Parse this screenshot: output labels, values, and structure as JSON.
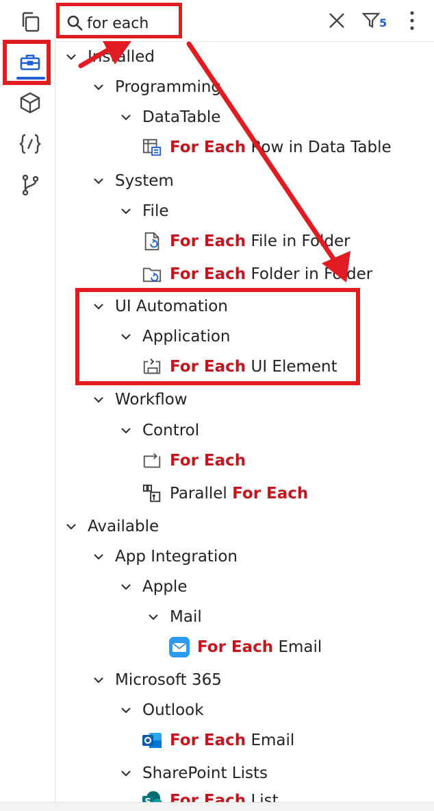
{
  "search": {
    "value": "for each"
  },
  "toolbar": {
    "filter_count": "5"
  },
  "rail_icons": [
    "files-icon",
    "toolbox-icon",
    "package-icon",
    "code-braces-icon",
    "git-branch-icon"
  ],
  "tree": {
    "installed": "Installed",
    "programming": "Programming",
    "datatable": "DataTable",
    "row_in_datatable": {
      "hl": "For Each",
      "rest": " Row in Data Table"
    },
    "system": "System",
    "file": "File",
    "file_in_folder": {
      "hl": "For Each",
      "rest": " File in Folder"
    },
    "folder_in_folder": {
      "hl": "For Each",
      "rest": " Folder in Folder"
    },
    "ui_automation": "UI Automation",
    "application": "Application",
    "ui_element": {
      "hl": "For Each",
      "rest": " UI Element"
    },
    "workflow": "Workflow",
    "control": "Control",
    "for_each": {
      "hl": "For Each"
    },
    "parallel": {
      "pre": "Parallel ",
      "hl": "For Each"
    },
    "available": "Available",
    "app_integration": "App Integration",
    "apple": "Apple",
    "mail": "Mail",
    "apple_email": {
      "hl": "For Each",
      "rest": " Email"
    },
    "ms365": "Microsoft 365",
    "outlook": "Outlook",
    "outlook_email": {
      "hl": "For Each",
      "rest": " Email"
    },
    "sharepoint_lists": "SharePoint Lists",
    "sharepoint_list": {
      "hl": "For Each",
      "rest": " List"
    }
  },
  "colors": {
    "annotation_red": "#e01b22",
    "highlight_red": "#c4141c",
    "accent_blue": "#1f5fcf"
  }
}
